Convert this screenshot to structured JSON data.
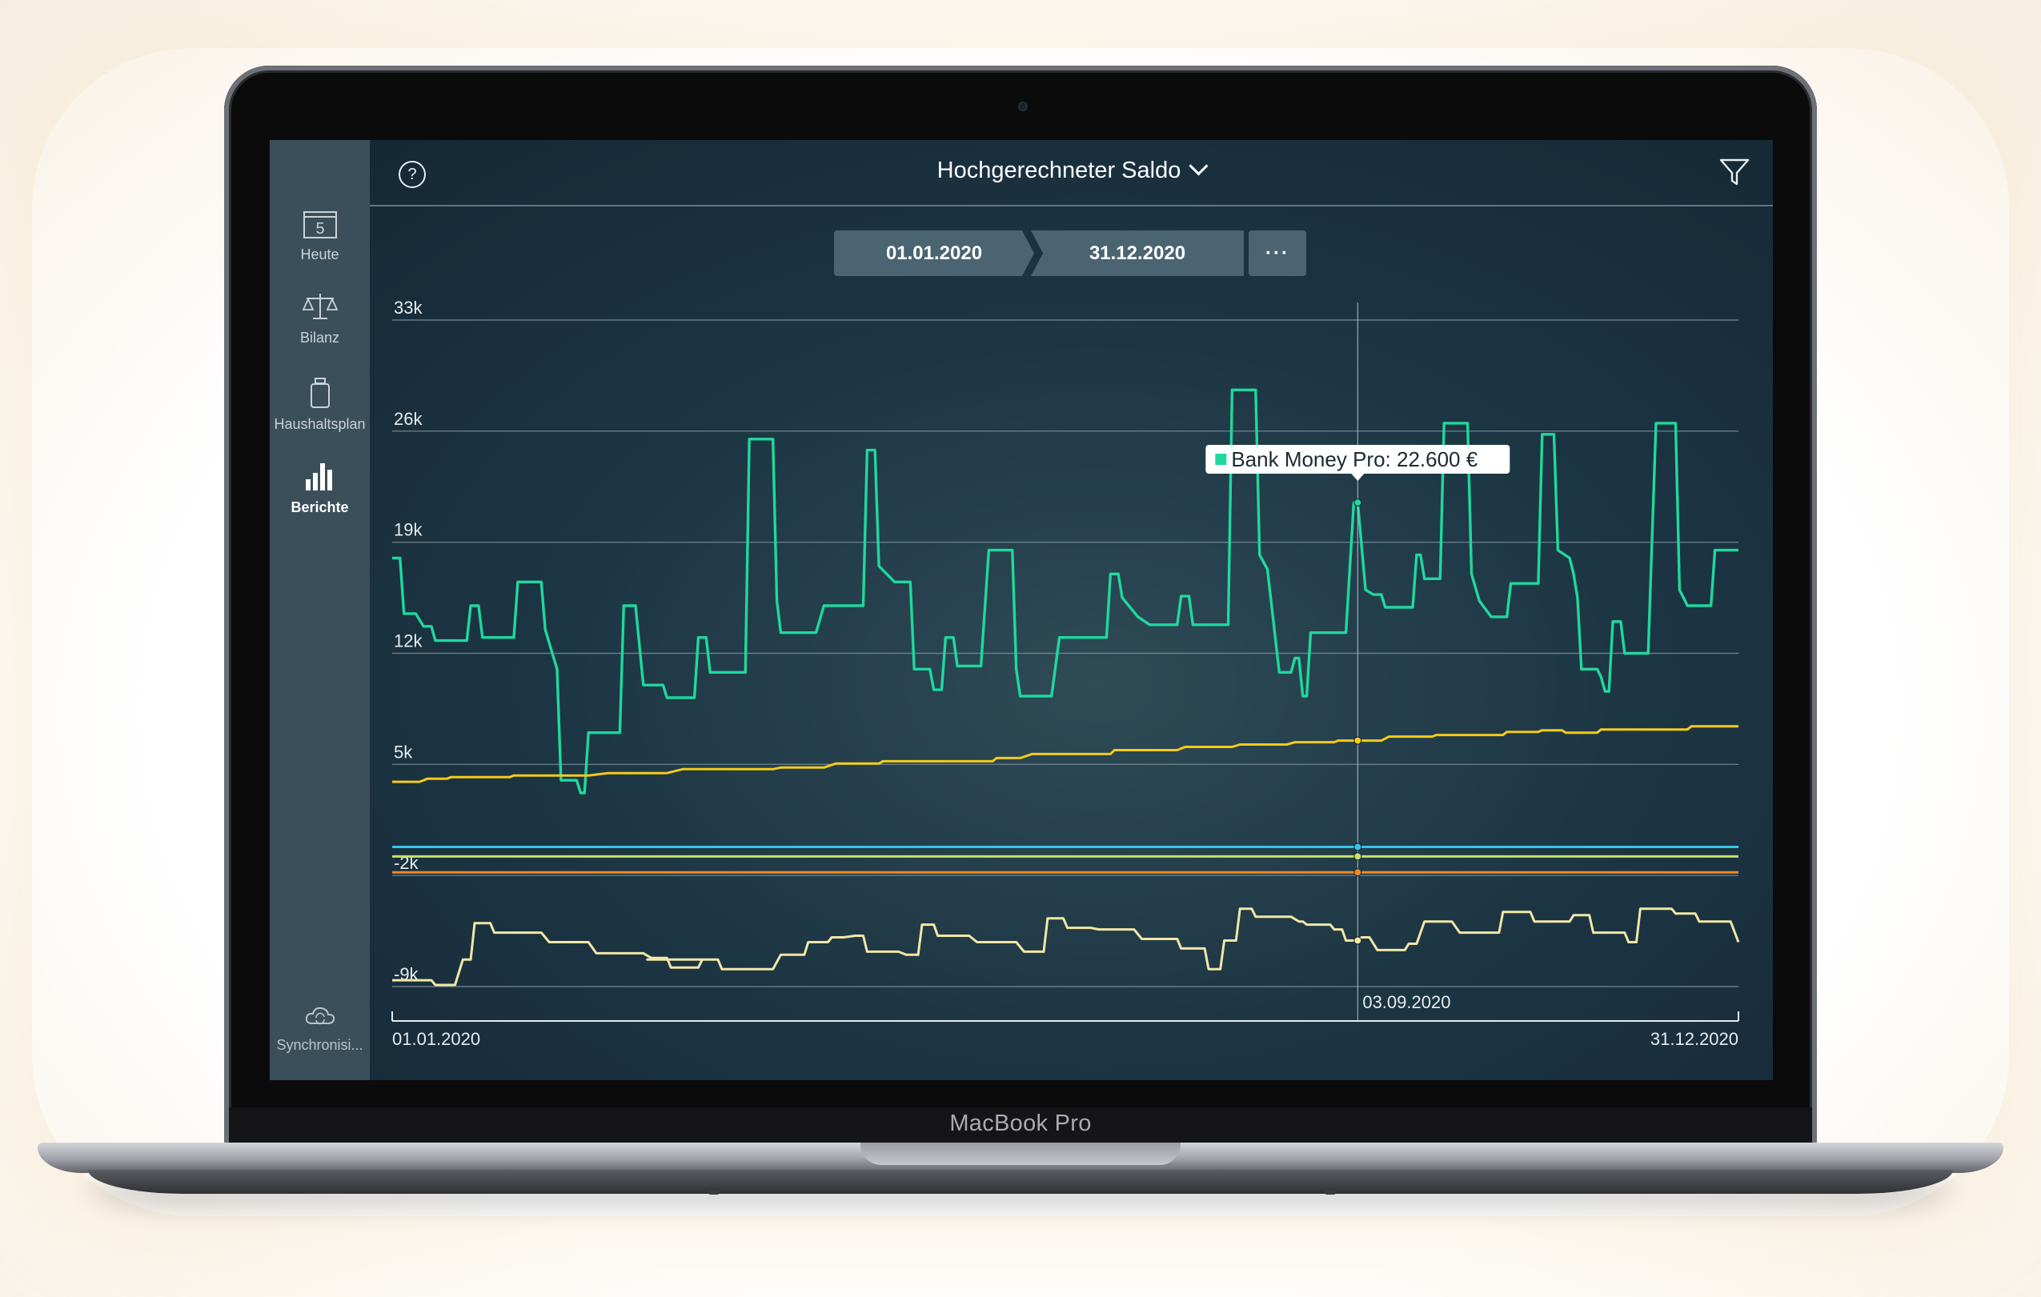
{
  "device": {
    "brand": "MacBook Pro"
  },
  "sidebar": {
    "items": [
      {
        "label": "Heute",
        "icon": "calendar-icon",
        "badge": "5"
      },
      {
        "label": "Bilanz",
        "icon": "scale-icon"
      },
      {
        "label": "Haushaltsplan",
        "icon": "jar-icon"
      },
      {
        "label": "Berichte",
        "icon": "bar-chart-icon"
      }
    ],
    "sync": {
      "label": "Synchronisi...",
      "icon": "cloud-sync-icon"
    }
  },
  "header": {
    "title": "Hochgerechneter Saldo",
    "help": "?",
    "filter_icon": "filter-icon"
  },
  "date_range": {
    "from": "01.01.2020",
    "to": "31.12.2020",
    "more": "···"
  },
  "tooltip": {
    "text": "Bank Money Pro: 22.600 €",
    "date": "03.09.2020"
  },
  "colors": {
    "green": "#1fd8a0",
    "yellow": "#f4cb1a",
    "cyan": "#34c6e8",
    "lime": "#c6e26a",
    "orange": "#f08a24",
    "pale": "#f1e7a6"
  },
  "chart_data": {
    "type": "line",
    "ylim": [
      -12000,
      33000
    ],
    "y_ticks": [
      33000,
      26000,
      19000,
      12000,
      5000,
      -2000,
      -9000
    ],
    "y_tick_labels": [
      "33k",
      "26k",
      "19k",
      "12k",
      "5k",
      "-2k",
      "-9k"
    ],
    "x_tick_labels": [
      "01.01.2020",
      "31.12.2020"
    ],
    "cursor_day": 246,
    "series": [
      {
        "name": "Bank Money Pro",
        "color": "#1fd8a0",
        "points": [
          [
            0,
            18000
          ],
          [
            2,
            18000
          ],
          [
            3,
            14500
          ],
          [
            6,
            14500
          ],
          [
            8,
            13700
          ],
          [
            10,
            13700
          ],
          [
            11,
            12800
          ],
          [
            19,
            12800
          ],
          [
            20,
            15000
          ],
          [
            22,
            15000
          ],
          [
            23,
            13000
          ],
          [
            31,
            13000
          ],
          [
            32,
            16500
          ],
          [
            38,
            16500
          ],
          [
            39,
            13500
          ],
          [
            42,
            11000
          ],
          [
            43,
            4000
          ],
          [
            47,
            4000
          ],
          [
            48,
            3200
          ],
          [
            49,
            3200
          ],
          [
            50,
            7000
          ],
          [
            58,
            7000
          ],
          [
            59,
            15000
          ],
          [
            62,
            15000
          ],
          [
            64,
            10000
          ],
          [
            69,
            10000
          ],
          [
            70,
            9200
          ],
          [
            77,
            9200
          ],
          [
            78,
            13000
          ],
          [
            80,
            13000
          ],
          [
            81,
            10800
          ],
          [
            90,
            10800
          ],
          [
            91,
            25500
          ],
          [
            97,
            25500
          ],
          [
            98,
            15300
          ],
          [
            99,
            13300
          ],
          [
            108,
            13300
          ],
          [
            110,
            15000
          ],
          [
            120,
            15000
          ],
          [
            121,
            24800
          ],
          [
            123,
            24800
          ],
          [
            124,
            17500
          ],
          [
            128,
            16500
          ],
          [
            132,
            16500
          ],
          [
            133,
            11000
          ],
          [
            137,
            11000
          ],
          [
            138,
            9700
          ],
          [
            140,
            9700
          ],
          [
            141,
            13000
          ],
          [
            143,
            13000
          ],
          [
            144,
            11200
          ],
          [
            150,
            11200
          ],
          [
            152,
            18500
          ],
          [
            158,
            18500
          ],
          [
            159,
            11000
          ],
          [
            160,
            9300
          ],
          [
            168,
            9300
          ],
          [
            170,
            13000
          ],
          [
            182,
            13000
          ],
          [
            183,
            17000
          ],
          [
            185,
            17000
          ],
          [
            186,
            15500
          ],
          [
            190,
            14300
          ],
          [
            193,
            13800
          ],
          [
            200,
            13800
          ],
          [
            201,
            15600
          ],
          [
            203,
            15600
          ],
          [
            204,
            13800
          ],
          [
            213,
            13800
          ],
          [
            214,
            28600
          ],
          [
            220,
            28600
          ],
          [
            221,
            18200
          ],
          [
            223,
            17300
          ],
          [
            226,
            10800
          ],
          [
            229,
            10800
          ],
          [
            230,
            11700
          ],
          [
            231,
            11700
          ],
          [
            232,
            9300
          ],
          [
            233,
            9300
          ],
          [
            234,
            13300
          ],
          [
            243,
            13300
          ],
          [
            245,
            21500
          ],
          [
            246,
            21500
          ],
          [
            248,
            16000
          ],
          [
            250,
            15700
          ],
          [
            252,
            15700
          ],
          [
            253,
            14900
          ],
          [
            260,
            14900
          ],
          [
            261,
            18200
          ],
          [
            262,
            18200
          ],
          [
            263,
            16700
          ],
          [
            267,
            16700
          ],
          [
            268,
            26500
          ],
          [
            274,
            26500
          ],
          [
            275,
            17000
          ],
          [
            277,
            15300
          ],
          [
            280,
            14300
          ],
          [
            284,
            14300
          ],
          [
            285,
            16400
          ],
          [
            292,
            16400
          ],
          [
            293,
            25800
          ],
          [
            296,
            25800
          ],
          [
            297,
            18500
          ],
          [
            300,
            18000
          ],
          [
            301,
            17000
          ],
          [
            302,
            15500
          ],
          [
            303,
            11000
          ],
          [
            307,
            11000
          ],
          [
            308,
            10500
          ],
          [
            309,
            9600
          ],
          [
            310,
            9600
          ],
          [
            311,
            14000
          ],
          [
            313,
            14000
          ],
          [
            314,
            12000
          ],
          [
            320,
            12000
          ],
          [
            322,
            26500
          ],
          [
            327,
            26500
          ],
          [
            328,
            16000
          ],
          [
            330,
            15000
          ],
          [
            336,
            15000
          ],
          [
            337,
            18500
          ],
          [
            343,
            18500
          ]
        ]
      },
      {
        "name": "",
        "color": "#f4cb1a",
        "points": [
          [
            0,
            3900
          ],
          [
            7,
            3900
          ],
          [
            9,
            4100
          ],
          [
            14,
            4100
          ],
          [
            15,
            4200
          ],
          [
            30,
            4200
          ],
          [
            31,
            4300
          ],
          [
            50,
            4300
          ],
          [
            55,
            4450
          ],
          [
            70,
            4450
          ],
          [
            74,
            4700
          ],
          [
            97,
            4700
          ],
          [
            99,
            4800
          ],
          [
            110,
            4800
          ],
          [
            113,
            5050
          ],
          [
            124,
            5050
          ],
          [
            125,
            5200
          ],
          [
            153,
            5200
          ],
          [
            154,
            5400
          ],
          [
            160,
            5400
          ],
          [
            163,
            5650
          ],
          [
            183,
            5650
          ],
          [
            184,
            5900
          ],
          [
            200,
            5900
          ],
          [
            202,
            6100
          ],
          [
            214,
            6100
          ],
          [
            216,
            6250
          ],
          [
            228,
            6250
          ],
          [
            230,
            6400
          ],
          [
            240,
            6400
          ],
          [
            241,
            6500
          ],
          [
            252,
            6500
          ],
          [
            254,
            6750
          ],
          [
            265,
            6750
          ],
          [
            266,
            6850
          ],
          [
            283,
            6850
          ],
          [
            284,
            7050
          ],
          [
            292,
            7050
          ],
          [
            293,
            7150
          ],
          [
            298,
            7150
          ],
          [
            299,
            7000
          ],
          [
            307,
            7000
          ],
          [
            308,
            7200
          ],
          [
            330,
            7200
          ],
          [
            331,
            7400
          ],
          [
            343,
            7400
          ]
        ]
      },
      {
        "name": "",
        "color": "#34c6e8",
        "points": [
          [
            0,
            -200
          ],
          [
            343,
            -200
          ]
        ]
      },
      {
        "name": "",
        "color": "#c6e26a",
        "points": [
          [
            0,
            -800
          ],
          [
            343,
            -800
          ]
        ]
      },
      {
        "name": "",
        "color": "#f08a24",
        "points": [
          [
            0,
            -1800
          ],
          [
            343,
            -1800
          ]
        ]
      },
      {
        "name": "",
        "color": "#f1e7a6",
        "points": [
          [
            0,
            -8600
          ],
          [
            10,
            -8600
          ],
          [
            11,
            -8900
          ],
          [
            16,
            -8900
          ],
          [
            18,
            -7300
          ],
          [
            20,
            -7300
          ],
          [
            21,
            -5000
          ],
          [
            25,
            -5000
          ],
          [
            26,
            -5600
          ],
          [
            38,
            -5600
          ],
          [
            40,
            -6200
          ],
          [
            50,
            -6200
          ],
          [
            52,
            -6900
          ],
          [
            64,
            -6900
          ],
          [
            66,
            -7200
          ],
          [
            70,
            -7200
          ],
          [
            71,
            -7800
          ],
          [
            78,
            -7800
          ],
          [
            79,
            -7300
          ],
          [
            65,
            -7300
          ],
          [
            65,
            -7300
          ],
          [
            78,
            -7300
          ],
          [
            79,
            -7300
          ],
          [
            83,
            -7300
          ],
          [
            84,
            -7900
          ],
          [
            97,
            -7900
          ],
          [
            99,
            -7000
          ],
          [
            105,
            -7000
          ],
          [
            106,
            -6200
          ],
          [
            111,
            -6200
          ],
          [
            112,
            -5900
          ],
          [
            115,
            -5900
          ],
          [
            118,
            -5800
          ],
          [
            120,
            -5800
          ],
          [
            121,
            -6800
          ],
          [
            129,
            -6800
          ],
          [
            131,
            -7000
          ],
          [
            134,
            -7000
          ],
          [
            135,
            -5100
          ],
          [
            138,
            -5100
          ],
          [
            139,
            -5800
          ],
          [
            147,
            -5800
          ],
          [
            149,
            -6200
          ],
          [
            159,
            -6200
          ],
          [
            161,
            -6800
          ],
          [
            166,
            -6800
          ],
          [
            167,
            -4700
          ],
          [
            171,
            -4700
          ],
          [
            172,
            -5300
          ],
          [
            178,
            -5300
          ],
          [
            180,
            -5400
          ],
          [
            189,
            -5400
          ],
          [
            191,
            -6000
          ],
          [
            200,
            -6000
          ],
          [
            201,
            -6600
          ],
          [
            207,
            -6600
          ],
          [
            208,
            -7900
          ],
          [
            211,
            -7900
          ],
          [
            212,
            -6100
          ],
          [
            215,
            -6100
          ],
          [
            216,
            -4100
          ],
          [
            219,
            -4100
          ],
          [
            220,
            -4600
          ],
          [
            229,
            -4600
          ],
          [
            231,
            -4900
          ],
          [
            232,
            -4900
          ],
          [
            233,
            -5100
          ],
          [
            239,
            -5100
          ],
          [
            240,
            -5400
          ],
          [
            242,
            -5400
          ],
          [
            243,
            -6100
          ],
          [
            246,
            -6100
          ],
          [
            247,
            -5900
          ],
          [
            249,
            -5900
          ],
          [
            251,
            -6700
          ],
          [
            258,
            -6700
          ],
          [
            259,
            -6300
          ],
          [
            261,
            -6300
          ],
          [
            263,
            -4900
          ],
          [
            270,
            -4900
          ],
          [
            272,
            -5600
          ],
          [
            282,
            -5600
          ],
          [
            283,
            -4300
          ],
          [
            290,
            -4300
          ],
          [
            291,
            -4900
          ],
          [
            300,
            -4900
          ],
          [
            301,
            -4500
          ],
          [
            305,
            -4500
          ],
          [
            306,
            -5600
          ],
          [
            314,
            -5600
          ],
          [
            315,
            -6200
          ],
          [
            317,
            -6200
          ],
          [
            318,
            -4100
          ],
          [
            326,
            -4100
          ],
          [
            327,
            -4400
          ],
          [
            332,
            -4400
          ],
          [
            333,
            -4900
          ],
          [
            341,
            -4900
          ],
          [
            343,
            -6200
          ]
        ]
      }
    ]
  }
}
